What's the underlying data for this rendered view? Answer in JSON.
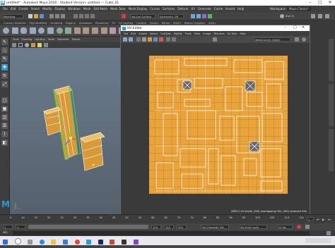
{
  "window": {
    "title": "untitled* - Autodesk Maya 2020 - Student Version: untitled   ---   Cube_01",
    "controls": [
      "–",
      "□",
      "✕"
    ]
  },
  "menubar": {
    "items": [
      "File",
      "Edit",
      "Create",
      "Select",
      "Modify",
      "Display",
      "Windows",
      "Mesh",
      "Edit Mesh",
      "Mesh Tools",
      "Mesh Display",
      "Curves",
      "Surfaces",
      "Deform",
      "UV",
      "Generate",
      "Cache",
      "Arnold",
      "Help"
    ],
    "workspace_label": "Workspace :",
    "workspace_value": "Maya Classic*"
  },
  "statusline": {
    "mode": "Modeling",
    "no_live_surface": "No Live Surface",
    "symmetry": "Symmetry: Off",
    "sign_in": "Sign In"
  },
  "shelf": {
    "tabs": [
      "Curves / Surfaces",
      "Poly Modeling",
      "Sculpting",
      "Rigging",
      "Animation",
      "Rendering",
      "FX",
      "FX Caching",
      "Custom",
      "Arnold",
      "Bifrost",
      "MASH",
      "Motion Graphics",
      "XGen"
    ]
  },
  "viewport": {
    "menu": [
      "View",
      "Shading",
      "Lighting",
      "Show",
      "Renderer",
      "Panels"
    ]
  },
  "uv_editor": {
    "title": "UV Editor",
    "menu": [
      "File",
      "Edit",
      "Create",
      "Select",
      "Cut/Sew",
      "Modify",
      "Tools",
      "View",
      "Image",
      "Textures",
      "UV Sets",
      "Help"
    ],
    "texture_name": "WallsCulvert_Adjmb",
    "status_text": "(8357) UV shells, (0/0) overlapping UVs, (0/0) reversed UVs"
  },
  "time_slider": {
    "ticks": [
      "5",
      "10",
      "15",
      "20",
      "25",
      "30",
      "35",
      "40",
      "45",
      "50",
      "55",
      "60",
      "65",
      "70",
      "75",
      "80",
      "85",
      "90",
      "95",
      "100",
      "105",
      "110",
      "115"
    ],
    "current_frame": "1"
  },
  "range_slider": {
    "start": "1",
    "inner_start": "1",
    "inner_end": "120",
    "end": "120",
    "end2": "200",
    "character_set": "No Character Set",
    "anim_layer": "No Anim Layer",
    "fps": "24 fps"
  },
  "command_line": {
    "label": "MEL"
  },
  "colors": {
    "uv_orange": "#e8a33a",
    "maya_blue": "#2e9bd6"
  }
}
